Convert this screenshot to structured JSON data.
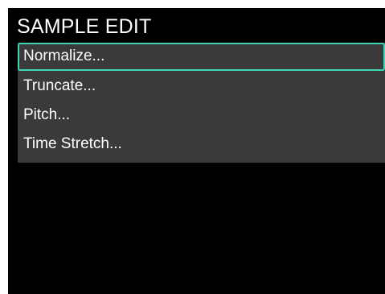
{
  "screen": {
    "title": "SAMPLE EDIT"
  },
  "menu": {
    "selected_index": 0,
    "items": [
      {
        "label": "Normalize..."
      },
      {
        "label": "Truncate..."
      },
      {
        "label": "Pitch..."
      },
      {
        "label": "Time Stretch..."
      }
    ]
  },
  "colors": {
    "background": "#000000",
    "menu_background": "#3a3a3a",
    "selection_outline": "#3fd4b4",
    "text": "#ffffff"
  }
}
